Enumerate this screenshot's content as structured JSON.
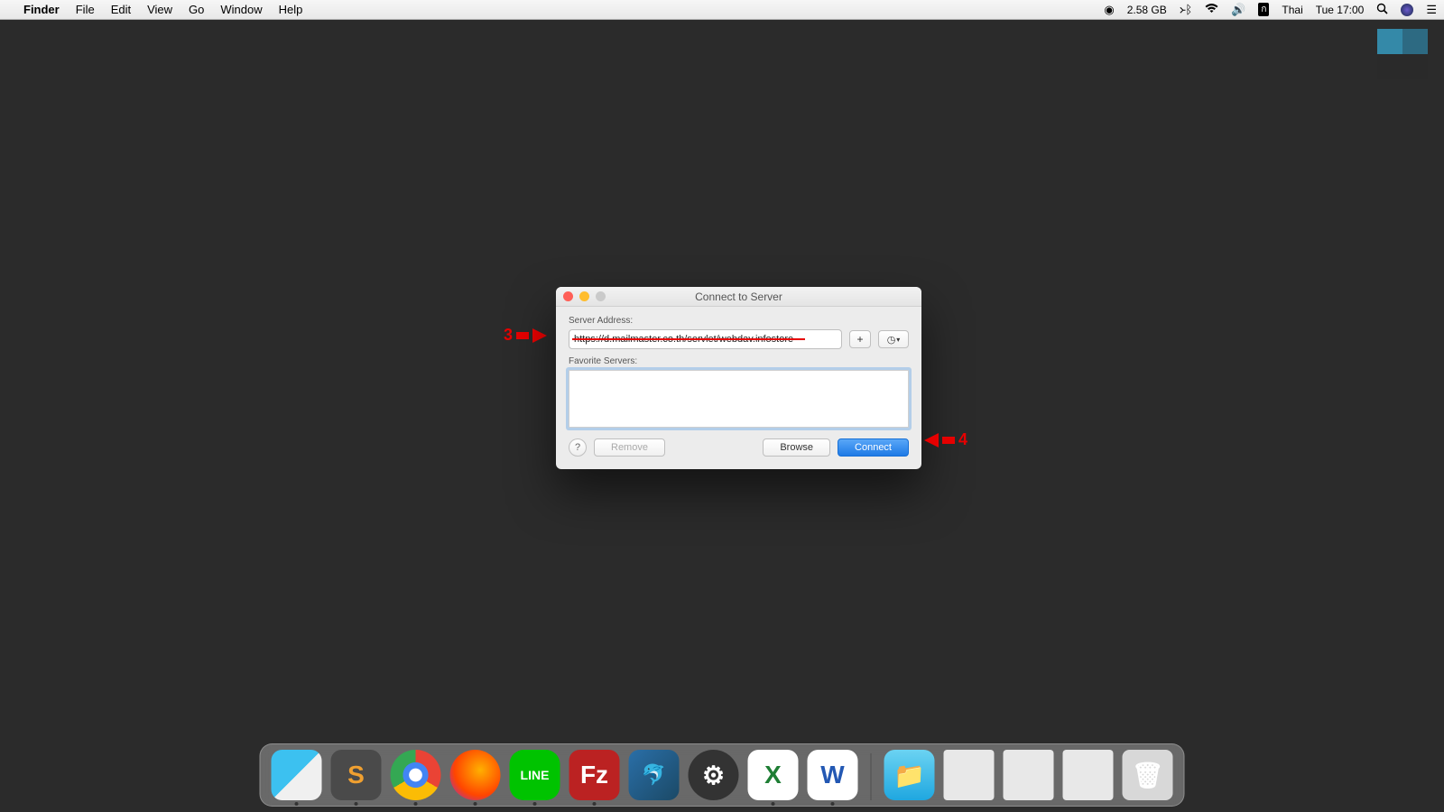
{
  "menubar": {
    "app": "Finder",
    "items": [
      "File",
      "Edit",
      "View",
      "Go",
      "Window",
      "Help"
    ],
    "status": {
      "memory": "2.58 GB",
      "input_method": "Thai",
      "datetime": "Tue 17:00"
    }
  },
  "dialog": {
    "title": "Connect to Server",
    "server_address_label": "Server Address:",
    "server_address_value": "https://d.mailmaster.co.th/servlet/webdav.infostore",
    "favorite_servers_label": "Favorite Servers:",
    "buttons": {
      "remove": "Remove",
      "browse": "Browse",
      "connect": "Connect"
    }
  },
  "annotations": {
    "step3": "3",
    "step4": "4"
  },
  "dock": {
    "apps": [
      {
        "name": "finder",
        "running": true
      },
      {
        "name": "sublime",
        "letter": "S",
        "running": true
      },
      {
        "name": "chrome",
        "running": true
      },
      {
        "name": "firefox",
        "running": true
      },
      {
        "name": "line",
        "letter": "LINE",
        "running": true
      },
      {
        "name": "filezilla",
        "letter": "Fz",
        "running": true
      },
      {
        "name": "mysql"
      },
      {
        "name": "settings",
        "letter": "⚙"
      },
      {
        "name": "excel",
        "letter": "X",
        "running": true
      },
      {
        "name": "word",
        "letter": "W",
        "running": true
      }
    ]
  }
}
